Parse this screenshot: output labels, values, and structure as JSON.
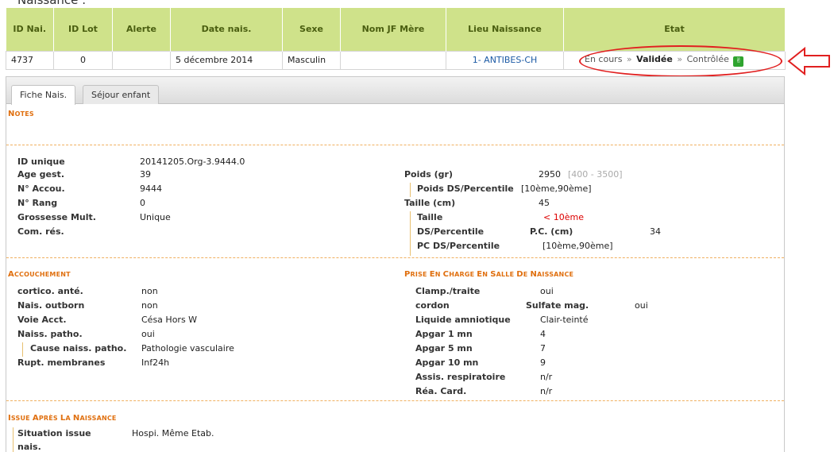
{
  "top_title_cut": "Naissance :",
  "table": {
    "headers": [
      "ID Nai.",
      "ID Lot",
      "Alerte",
      "Date nais.",
      "Sexe",
      "Nom JF Mère",
      "Lieu Naissance",
      "Etat"
    ],
    "row": {
      "id": "4737",
      "lot": "0",
      "alerte": "",
      "date": "5 décembre 2014",
      "sexe": "Masculin",
      "nom_jf": "",
      "lieu": "1- ANTIBES-CH",
      "etat": {
        "en_cours": "En cours",
        "validee": "Validée",
        "controlee": "Contrôlée",
        "sep": "»"
      }
    }
  },
  "tabs": [
    "Fiche Nais.",
    "Séjour enfant"
  ],
  "sections": {
    "notes": "Notes",
    "accouchement": "Accouchement",
    "prise_en_charge": "Prise en charge en salle de naissance",
    "issue": "Issue après la naissance"
  },
  "identity": {
    "id_unique": {
      "label": "ID unique",
      "value": "20141205.Org-3.9444.0"
    },
    "age_gest": {
      "label": "Age gest.",
      "value": "39"
    },
    "accou": {
      "label": "N° Accou.",
      "value": "9444"
    },
    "rang": {
      "label": "N° Rang",
      "value": "0"
    },
    "grossesse": {
      "label": "Grossesse Mult.",
      "value": "Unique"
    },
    "com_res": {
      "label": "Com. rés.",
      "value": ""
    }
  },
  "measures": {
    "poids": {
      "label": "Poids (gr)",
      "value": "2950",
      "range": "[400 - 3500]"
    },
    "poids_ds": {
      "label": "Poids DS/Percentile",
      "value": "[10ème,90ème]"
    },
    "taille_cm": {
      "label": "Taille (cm)",
      "value": "45"
    },
    "taille": {
      "label": "Taille",
      "value": "< 10ème"
    },
    "ds_percentile": {
      "label": "DS/Percentile"
    },
    "pc": {
      "label": "P.C. (cm)",
      "value": "34"
    },
    "pc_ds": {
      "label": "PC DS/Percentile",
      "value": "[10ème,90ème]"
    }
  },
  "accouchement": {
    "cortico": {
      "label": "cortico. anté.",
      "value": "non"
    },
    "outborn": {
      "label": "Nais. outborn",
      "value": "non"
    },
    "voie": {
      "label": "Voie Acct.",
      "value": "Césa Hors W"
    },
    "patho": {
      "label": "Naiss. patho.",
      "value": "oui"
    },
    "cause": {
      "label": "Cause naiss. patho.",
      "value": "Pathologie vasculaire"
    },
    "rupt": {
      "label": "Rupt. membranes",
      "value": "Inf24h"
    }
  },
  "prise": {
    "clamp": {
      "label": "Clamp./traite",
      "value": "oui"
    },
    "cordon": {
      "label": "cordon"
    },
    "sulfate": {
      "label": "Sulfate mag.",
      "value": "oui"
    },
    "liquide": {
      "label": "Liquide amniotique",
      "value": "Clair-teinté"
    },
    "apgar1": {
      "label": "Apgar 1 mn",
      "value": "4"
    },
    "apgar5": {
      "label": "Apgar 5 mn",
      "value": "7"
    },
    "apgar10": {
      "label": "Apgar 10 mn",
      "value": "9"
    },
    "assis": {
      "label": "Assis. respiratoire",
      "value": "n/r"
    },
    "rea": {
      "label": "Réa. Card.",
      "value": "n/r"
    }
  },
  "issue": {
    "situation": {
      "label_1": "Situation issue",
      "label_2": "nais.",
      "value": "Hospi. Même Etab."
    }
  },
  "colors": {
    "header_bg": "#cfe28a",
    "section": "#e07010",
    "highlight": "#e12020",
    "link": "#1c5aa5"
  },
  "icons": {
    "etat_icon": "thumbs-up-icon",
    "arrow": "left-arrow-icon"
  }
}
